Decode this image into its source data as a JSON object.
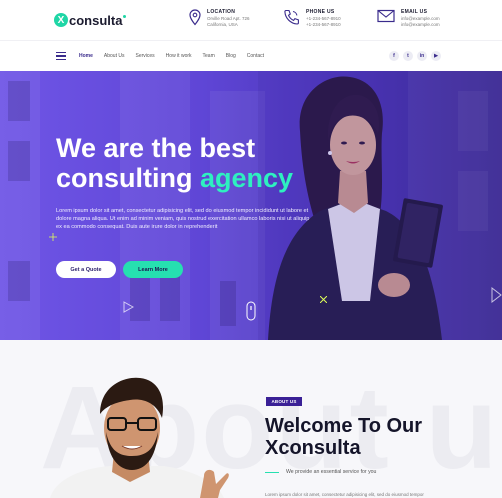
{
  "brand": {
    "logo_letter": "X",
    "name": "consulta"
  },
  "contacts": [
    {
      "title": "LOCATION",
      "line1": "Orville Road Apt. 726",
      "line2": "California, USA",
      "icon": "map-pin-icon"
    },
    {
      "title": "PHONE US",
      "line1": "+1-234-567-8910",
      "line2": "+1-234-567-8910",
      "icon": "phone-icon"
    },
    {
      "title": "EMAIL US",
      "line1": "info@example.com",
      "line2": "info@example.com",
      "icon": "mail-icon"
    }
  ],
  "nav": {
    "items": [
      "Home",
      "About Us",
      "Services",
      "How it work",
      "Team",
      "Blog",
      "Contact"
    ],
    "active": "Home"
  },
  "socials": [
    {
      "label": "f",
      "icon": "facebook-icon"
    },
    {
      "label": "t",
      "icon": "twitter-icon"
    },
    {
      "label": "in",
      "icon": "linkedin-icon"
    },
    {
      "label": "▶",
      "icon": "youtube-icon"
    }
  ],
  "hero": {
    "title_line1": "We are the best",
    "title_line2_plain": "consulting ",
    "title_line2_accent": "agency",
    "description": "Lorem ipsum dolor sit amet, consectetur adipisicing elit, sed do eiusmod tempor incididunt ut labore et dolore magna aliqua. Ut enim ad minim veniam, quis nostrud exercitation ullamco laboris nisi ut aliquip ex ea commodo consequat. Duis aute irure dolor in reprehenderit",
    "cta_primary": "Get a Quote",
    "cta_secondary": "Learn More"
  },
  "about": {
    "watermark": "About us",
    "badge": "ABOUT US",
    "title_line1": "Welcome To Our",
    "title_line2": "Xconsulta",
    "subtitle": "We provide an essential service for you",
    "paragraph": "Lorem ipsum dolor sit amet, consectetur adipisicing elit, sed do eiusmod tempor"
  },
  "colors": {
    "brand_purple": "#3a2b8c",
    "accent_green": "#26e0b0",
    "hero_purple": "#5f46d6"
  }
}
